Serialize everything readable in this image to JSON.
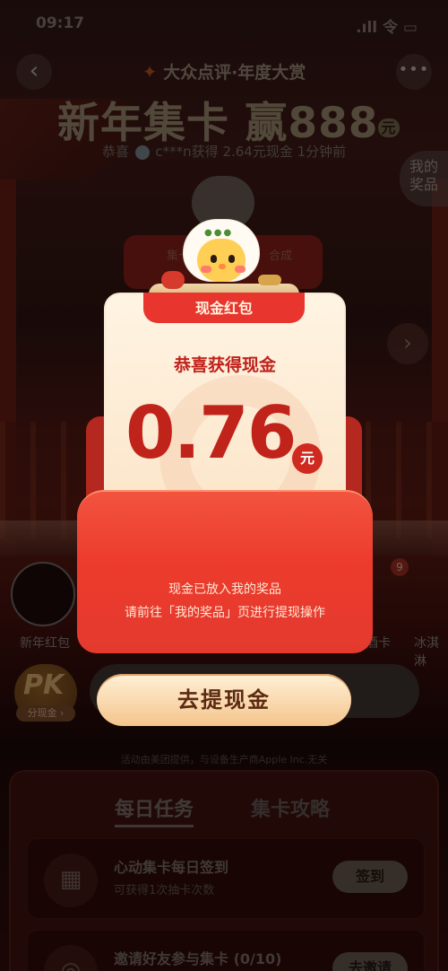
{
  "status_bar": {
    "time": "09:17",
    "right": ".ıll 令 ▭"
  },
  "header": {
    "brand": "大众点评·年度大赏",
    "title_main": "新年集卡 赢888",
    "title_unit": "元",
    "ticker_prefix": "恭喜",
    "ticker_text": "c***n获得 2.64元现金 1分钟前"
  },
  "side": {
    "my_prizes": "我的奖品"
  },
  "card_stack": {
    "left": "集卡",
    "right": "合成"
  },
  "row": {
    "items": [
      {
        "label": "新年红包"
      },
      {
        "label": "醉酒卡"
      },
      {
        "label": "冰淇淋"
      }
    ],
    "badge": "9"
  },
  "pk": {
    "label": "PK",
    "sub": "分现金 ›"
  },
  "disclaimer": "活动由美团提供，与设备生产商Apple Inc.无关",
  "tasks": {
    "tabs": [
      "每日任务",
      "集卡攻略"
    ],
    "items": [
      {
        "title": "心动集卡每日签到",
        "sub": "可获得1次抽卡次数",
        "button": "签到"
      },
      {
        "title": "邀请好友参与集卡 (0/10)",
        "sub": "",
        "button": "去邀请"
      }
    ]
  },
  "modal": {
    "ribbon": "现金红包",
    "congrats": "恭喜获得现金",
    "amount": "0.76",
    "unit": "元",
    "message_line1": "现金已放入我的奖品",
    "message_line2": "请前往「我的奖品」页进行提现操作",
    "cta": "去提现金"
  },
  "colors": {
    "accent_red": "#e43a2e",
    "amount_red": "#c0231a",
    "cta_gold": "#f4c58c"
  }
}
